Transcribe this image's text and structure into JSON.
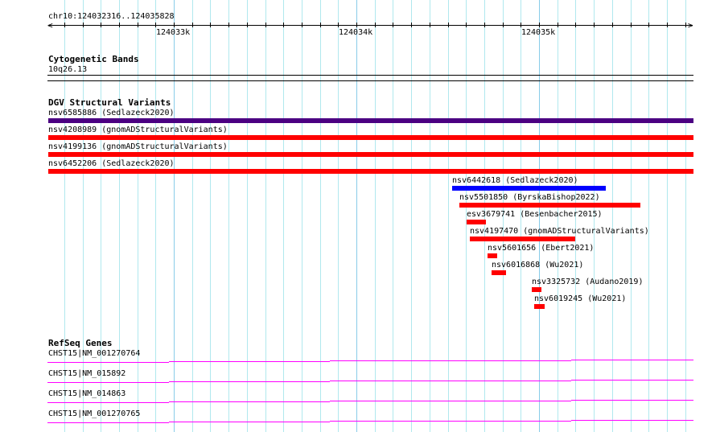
{
  "ruler": {
    "location": "chr10:124032316..124035828",
    "ticks": [
      "124033k",
      "124034k",
      "124035k"
    ]
  },
  "cytobands": {
    "title": "Cytogenetic Bands",
    "band": "10q26.13"
  },
  "dgv": {
    "title": "DGV Structural Variants",
    "features": [
      {
        "label": "nsv6585886 (Sedlazeck2020)",
        "color": "#4b0082"
      },
      {
        "label": "nsv4208989 (gnomADStructuralVariants)",
        "color": "#ff0000"
      },
      {
        "label": "nsv4199136 (gnomADStructuralVariants)",
        "color": "#ff0000"
      },
      {
        "label": "nsv6452206 (Sedlazeck2020)",
        "color": "#ff0000"
      },
      {
        "label": "nsv6442618 (Sedlazeck2020)",
        "color": "#0000ff"
      },
      {
        "label": "nsv5501850 (ByrskaBishop2022)",
        "color": "#ff0000"
      },
      {
        "label": "esv3679741 (Besenbacher2015)",
        "color": "#ff0000"
      },
      {
        "label": "nsv4197470 (gnomADStructuralVariants)",
        "color": "#ff0000"
      },
      {
        "label": "nsv5601656 (Ebert2021)",
        "color": "#ff0000"
      },
      {
        "label": "nsv6016868 (Wu2021)",
        "color": "#ff0000"
      },
      {
        "label": "nsv3325732 (Audano2019)",
        "color": "#ff0000"
      },
      {
        "label": "nsv6019245 (Wu2021)",
        "color": "#ff0000"
      }
    ]
  },
  "refseq": {
    "title": "RefSeq Genes",
    "color": "#ff00ff",
    "genes": [
      {
        "label": "CHST15|NM_001270764"
      },
      {
        "label": "CHST15|NM_015892"
      },
      {
        "label": "CHST15|NM_014863"
      },
      {
        "label": "CHST15|NM_001270765"
      }
    ]
  }
}
